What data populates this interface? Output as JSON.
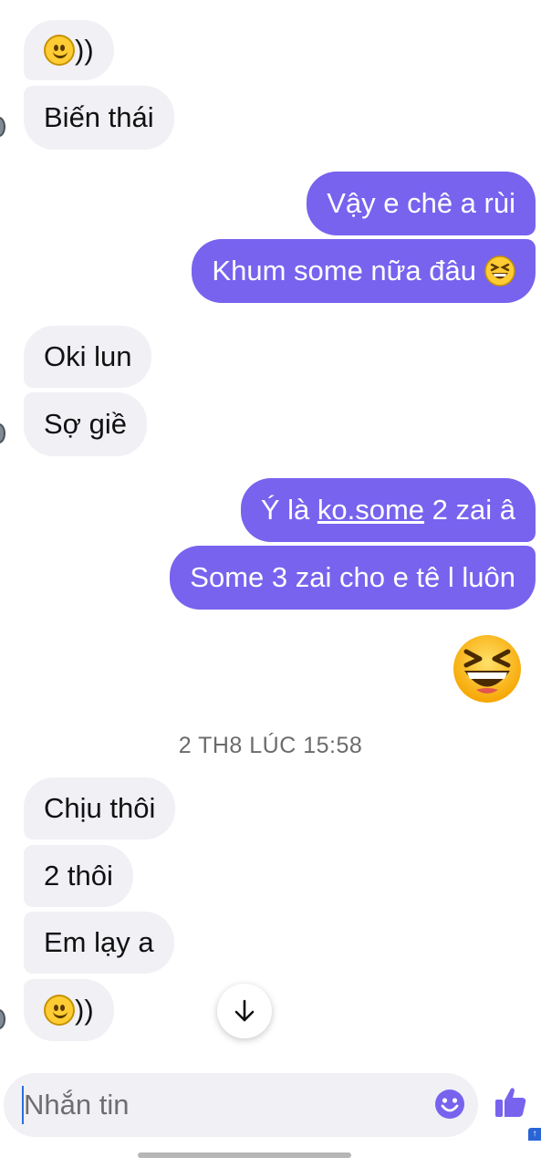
{
  "messages": [
    {
      "id": "m1",
      "side": "incoming",
      "emoji": "slightly-smiling-face",
      "text": "))"
    },
    {
      "id": "m2",
      "side": "incoming",
      "text": "Biến thái"
    },
    {
      "id": "m3",
      "side": "outgoing",
      "text": "Vậy e chê a rùi"
    },
    {
      "id": "m4",
      "side": "outgoing",
      "text": "Khum some nữa đâu",
      "emoji": "grinning-squinting-face"
    },
    {
      "id": "m5",
      "side": "incoming",
      "text": "Oki lun"
    },
    {
      "id": "m6",
      "side": "incoming",
      "text": "Sợ giề"
    },
    {
      "id": "m7",
      "side": "outgoing",
      "text_before": "Ý là ",
      "link": "ko.some",
      "text_after": " 2 zai â"
    },
    {
      "id": "m8",
      "side": "outgoing",
      "text": "Some 3 zai cho e tê l luôn"
    },
    {
      "id": "m9",
      "side": "outgoing",
      "emoji": "grinning-squinting-face-large"
    },
    {
      "id": "m10",
      "side": "incoming",
      "text": "Chịu thôi"
    },
    {
      "id": "m11",
      "side": "incoming",
      "text": "2 thôi"
    },
    {
      "id": "m12",
      "side": "incoming",
      "text": "Em lạy a"
    },
    {
      "id": "m13",
      "side": "incoming",
      "emoji": "slightly-smiling-face",
      "text": "))"
    }
  ],
  "timestamp": "2 TH8 LÚC 15:58",
  "scroll_button": {
    "icon": "arrow-down-icon"
  },
  "composer": {
    "placeholder": "Nhắn tin",
    "value": "",
    "emoji_icon": "emoji-icon",
    "send_icon": "thumbs-up-icon"
  },
  "colors": {
    "outgoing_bubble": "#7763ee",
    "incoming_bubble": "#f0f0f5",
    "accent": "#7763ee",
    "timestamp_text": "#6b6b6b"
  }
}
